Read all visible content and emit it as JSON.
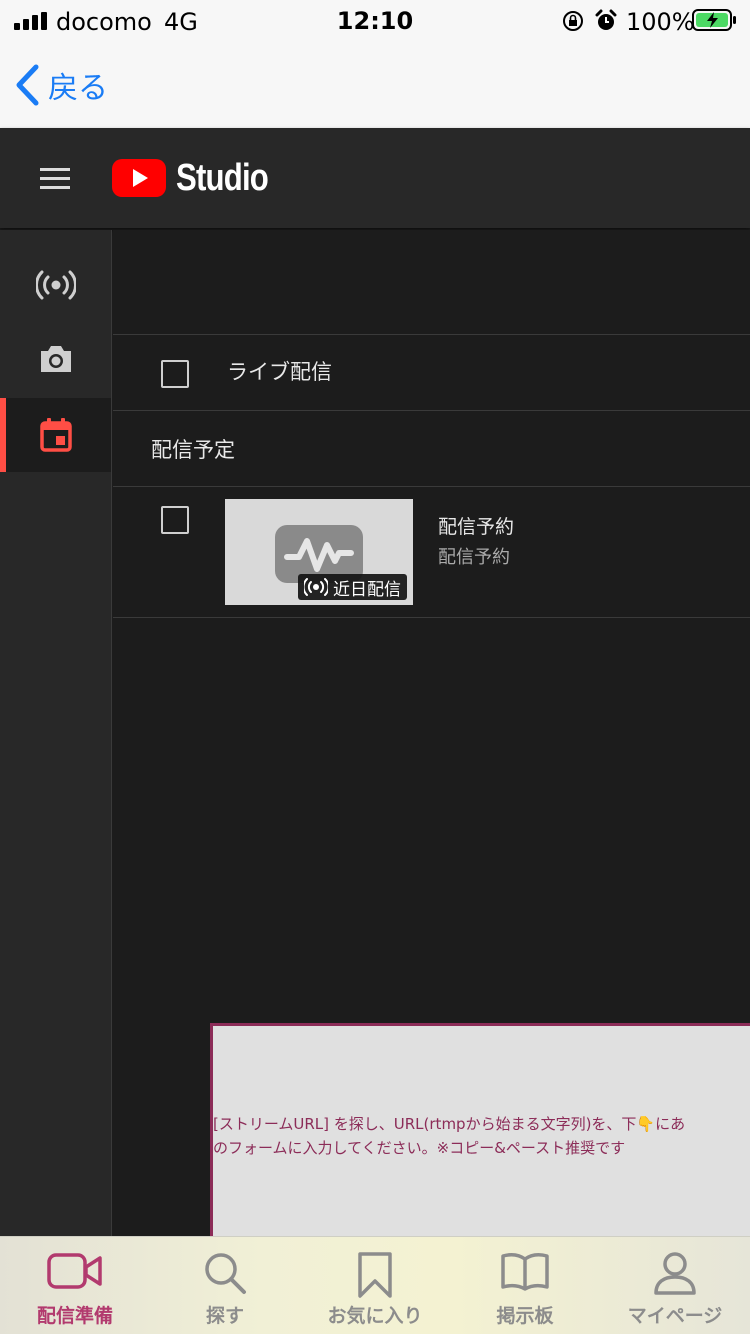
{
  "status_bar": {
    "carrier": "docomo",
    "network": "4G",
    "time": "12:10",
    "battery": "100%"
  },
  "nav": {
    "back_label": "戻る"
  },
  "header": {
    "logo_text": "Studio"
  },
  "rail": {
    "items": [
      {
        "name": "live-icon",
        "active": false
      },
      {
        "name": "camera-icon",
        "active": false
      },
      {
        "name": "calendar-icon",
        "active": true
      }
    ]
  },
  "list": {
    "live_row_label": "ライブ配信",
    "section_label": "配信予定",
    "video": {
      "title": "配信予約",
      "subtitle": "配信予約",
      "badge": "近日配信"
    }
  },
  "overlay": {
    "line1": "[ストリームURL] を探し、URL(rtmpから始まる文字列)を、下👇にあ",
    "line2": "のフォームに入力してください。※コピー&ペースト推奨です"
  },
  "tabs": [
    {
      "label": "配信準備",
      "icon": "video-camera-icon",
      "active": true
    },
    {
      "label": "探す",
      "icon": "search-icon",
      "active": false
    },
    {
      "label": "お気に入り",
      "icon": "bookmark-icon",
      "active": false
    },
    {
      "label": "掲示板",
      "icon": "book-icon",
      "active": false
    },
    {
      "label": "マイページ",
      "icon": "person-icon",
      "active": false
    }
  ],
  "colors": {
    "accent_red": "#ff4e45",
    "ios_blue": "#1a7cf5",
    "brand_magenta": "#b23a6e"
  }
}
